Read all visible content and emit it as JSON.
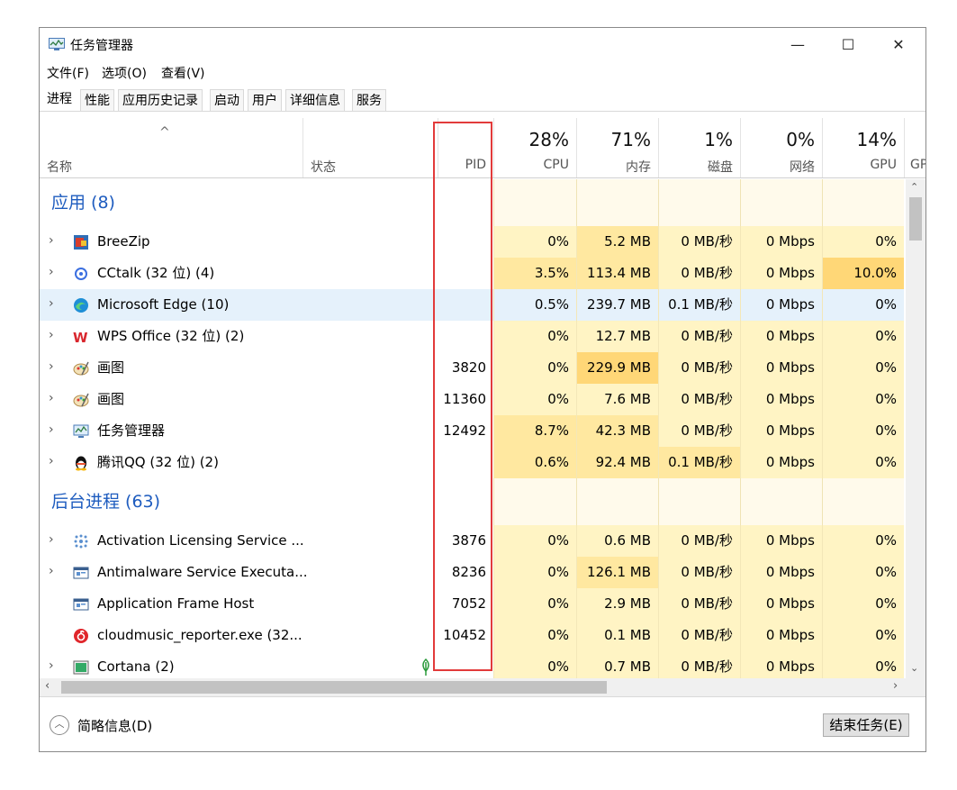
{
  "window": {
    "title": "任务管理器",
    "minimize": "—",
    "maximize": "☐",
    "close": "✕"
  },
  "menu": [
    "文件(F)",
    "选项(O)",
    "查看(V)"
  ],
  "tabs": [
    "进程",
    "性能",
    "应用历史记录",
    "启动",
    "用户",
    "详细信息",
    "服务"
  ],
  "header": {
    "sort_caret": "^",
    "name": "名称",
    "status": "状态",
    "pid": "PID",
    "cpu": {
      "pct": "28%",
      "label": "CPU"
    },
    "memory": {
      "pct": "71%",
      "label": "内存"
    },
    "disk": {
      "pct": "1%",
      "label": "磁盘"
    },
    "network": {
      "pct": "0%",
      "label": "网络"
    },
    "gpu": {
      "pct": "14%",
      "label": "GPU"
    },
    "gpu_engine_partial": "GP"
  },
  "groups": {
    "apps": "应用 (8)",
    "background": "后台进程 (63)"
  },
  "rows": [
    {
      "name": "BreeZip",
      "pid": "",
      "cpu": "0%",
      "mem": "5.2 MB",
      "disk": "0 MB/秒",
      "net": "0 Mbps",
      "gpu": "0%",
      "icon": "breezip-icon"
    },
    {
      "name": "CCtalk (32 位) (4)",
      "pid": "",
      "cpu": "3.5%",
      "mem": "113.4 MB",
      "disk": "0 MB/秒",
      "net": "0 Mbps",
      "gpu": "10.0%",
      "icon": "cctalk-icon"
    },
    {
      "name": "Microsoft Edge (10)",
      "pid": "",
      "cpu": "0.5%",
      "mem": "239.7 MB",
      "disk": "0.1 MB/秒",
      "net": "0 Mbps",
      "gpu": "0%",
      "icon": "edge-icon"
    },
    {
      "name": "WPS Office (32 位) (2)",
      "pid": "",
      "cpu": "0%",
      "mem": "12.7 MB",
      "disk": "0 MB/秒",
      "net": "0 Mbps",
      "gpu": "0%",
      "icon": "wps-icon"
    },
    {
      "name": "画图",
      "pid": "3820",
      "cpu": "0%",
      "mem": "229.9 MB",
      "disk": "0 MB/秒",
      "net": "0 Mbps",
      "gpu": "0%",
      "icon": "paint-icon"
    },
    {
      "name": "画图",
      "pid": "11360",
      "cpu": "0%",
      "mem": "7.6 MB",
      "disk": "0 MB/秒",
      "net": "0 Mbps",
      "gpu": "0%",
      "icon": "paint-icon"
    },
    {
      "name": "任务管理器",
      "pid": "12492",
      "cpu": "8.7%",
      "mem": "42.3 MB",
      "disk": "0 MB/秒",
      "net": "0 Mbps",
      "gpu": "0%",
      "icon": "task-manager-icon"
    },
    {
      "name": "腾讯QQ (32 位) (2)",
      "pid": "",
      "cpu": "0.6%",
      "mem": "92.4 MB",
      "disk": "0.1 MB/秒",
      "net": "0 Mbps",
      "gpu": "0%",
      "icon": "qq-icon"
    },
    {
      "name": "Activation Licensing Service ...",
      "pid": "3876",
      "cpu": "0%",
      "mem": "0.6 MB",
      "disk": "0 MB/秒",
      "net": "0 Mbps",
      "gpu": "0%",
      "icon": "service-icon"
    },
    {
      "name": "Antimalware Service Executa...",
      "pid": "8236",
      "cpu": "0%",
      "mem": "126.1 MB",
      "disk": "0 MB/秒",
      "net": "0 Mbps",
      "gpu": "0%",
      "icon": "app-window-icon"
    },
    {
      "name": "Application Frame Host",
      "pid": "7052",
      "cpu": "0%",
      "mem": "2.9 MB",
      "disk": "0 MB/秒",
      "net": "0 Mbps",
      "gpu": "0%",
      "icon": "app-window-icon"
    },
    {
      "name": "cloudmusic_reporter.exe (32...",
      "pid": "10452",
      "cpu": "0%",
      "mem": "0.1 MB",
      "disk": "0 MB/秒",
      "net": "0 Mbps",
      "gpu": "0%",
      "icon": "cloudmusic-icon"
    },
    {
      "name": "Cortana (2)",
      "pid": "",
      "cpu": "0%",
      "mem": "0.7 MB",
      "disk": "0 MB/秒",
      "net": "0 Mbps",
      "gpu": "0%",
      "icon": "cortana-icon",
      "status_icon": "leaf-icon"
    }
  ],
  "footer": {
    "details": "简略信息(D)",
    "end_task": "结束任务(E)"
  },
  "colors": {
    "heat_light": "#fff4c4",
    "heat_mid": "#ffe8a0",
    "heat_high": "#ffd777",
    "selected": "#e5f1fb",
    "group_title": "#1e5cbf",
    "highlight_box": "#e23b3b"
  }
}
